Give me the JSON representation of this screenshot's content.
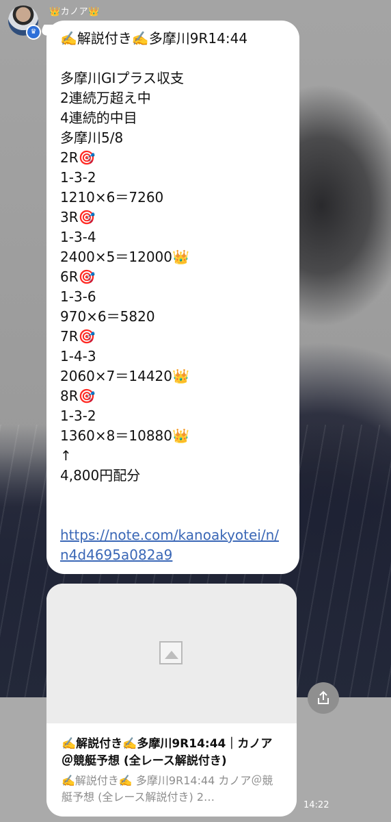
{
  "sender": {
    "name": "👑カノア👑"
  },
  "message": {
    "title": "✍️解説付き✍️多摩川9R14:44",
    "lines": [
      "多摩川GIプラス収支",
      "2連続万超え中",
      "4連続的中目",
      "多摩川5/8",
      "2R🎯",
      "1-3-2",
      "1210×6＝7260",
      "3R🎯",
      "1-3-4",
      "2400×5＝12000👑",
      "6R🎯",
      "1-3-6",
      "970×6＝5820",
      "7R🎯",
      "1-4-3",
      "2060×7＝14420👑",
      "8R🎯",
      "1-3-2",
      "1360×8＝10880👑",
      "↑",
      "4,800円配分"
    ],
    "link": "https://note.com/kanoakyotei/n/n4d4695a082a9"
  },
  "card": {
    "title": "✍️解説付き✍️多摩川9R14:44｜カノア＠競艇予想 (全レース解説付き)",
    "description": "✍️解説付き✍️ 多摩川9R14:44 カノア＠競艇予想 (全レース解説付き) 2…"
  },
  "timestamp": "14:22",
  "icons": {
    "share": "share-icon",
    "image_placeholder": "image-placeholder-icon",
    "verified": "verified-crown-icon"
  }
}
